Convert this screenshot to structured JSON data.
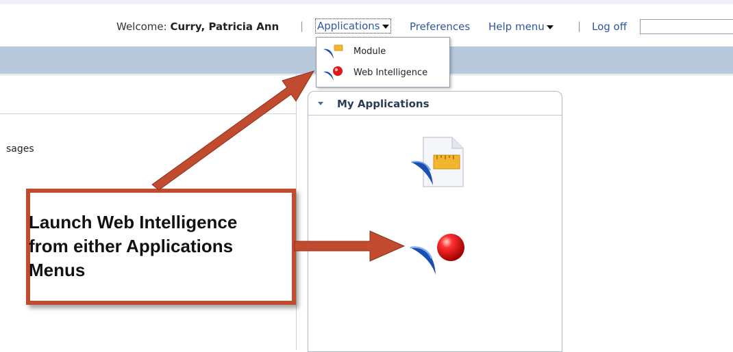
{
  "header": {
    "welcome_label": "Welcome:",
    "user_name": "Curry, Patricia Ann",
    "applications_label": "Applications",
    "preferences_label": "Preferences",
    "help_menu_label": "Help menu",
    "logoff_label": "Log off",
    "search_value": ""
  },
  "applications_menu": {
    "items": [
      {
        "label": "Module",
        "icon": "module-icon"
      },
      {
        "label": "Web Intelligence",
        "icon": "web-intelligence-icon"
      }
    ]
  },
  "left_panel": {
    "messages_fragment": "sages"
  },
  "my_applications": {
    "title": "My Applications",
    "apps": [
      {
        "icon": "module-document-icon"
      },
      {
        "icon": "web-intelligence-icon"
      }
    ]
  },
  "annotation": {
    "text": "Launch Web Intelligence from either Applications Menus",
    "color": "#c14b2e"
  }
}
